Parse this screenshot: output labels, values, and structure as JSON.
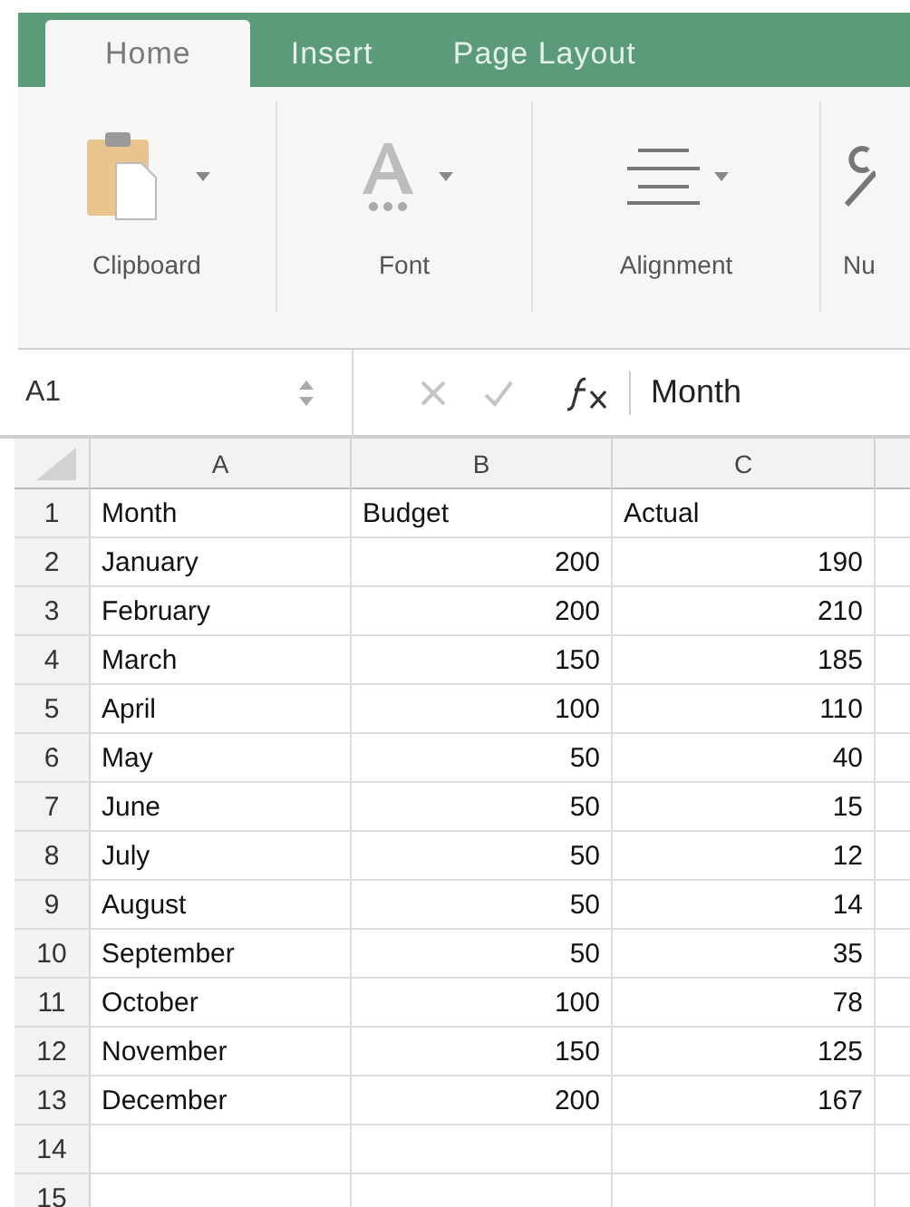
{
  "tabs": [
    {
      "label": "Home",
      "selected": true
    },
    {
      "label": "Insert",
      "selected": false
    },
    {
      "label": "Page Layout",
      "selected": false
    }
  ],
  "ribbon": {
    "groups": [
      {
        "label": "Clipboard",
        "kind": "clipboard"
      },
      {
        "label": "Font",
        "kind": "font"
      },
      {
        "label": "Alignment",
        "kind": "alignment"
      },
      {
        "label": "Nu",
        "kind": "number"
      }
    ]
  },
  "formula_bar": {
    "name_box": "A1",
    "formula": "Month"
  },
  "sheet": {
    "columns": [
      "A",
      "B",
      "C"
    ],
    "rows": [
      {
        "number": "1",
        "kind": "text",
        "cells": [
          "Month",
          "Budget",
          "Actual"
        ]
      },
      {
        "number": "2",
        "kind": "number",
        "cells": [
          "January",
          "200",
          "190"
        ]
      },
      {
        "number": "3",
        "kind": "number",
        "cells": [
          "February",
          "200",
          "210"
        ]
      },
      {
        "number": "4",
        "kind": "number",
        "cells": [
          "March",
          "150",
          "185"
        ]
      },
      {
        "number": "5",
        "kind": "number",
        "cells": [
          "April",
          "100",
          "110"
        ]
      },
      {
        "number": "6",
        "kind": "number",
        "cells": [
          "May",
          "50",
          "40"
        ]
      },
      {
        "number": "7",
        "kind": "number",
        "cells": [
          "June",
          "50",
          "15"
        ]
      },
      {
        "number": "8",
        "kind": "number",
        "cells": [
          "July",
          "50",
          "12"
        ]
      },
      {
        "number": "9",
        "kind": "number",
        "cells": [
          "August",
          "50",
          "14"
        ]
      },
      {
        "number": "10",
        "kind": "number",
        "cells": [
          "September",
          "50",
          "35"
        ]
      },
      {
        "number": "11",
        "kind": "number",
        "cells": [
          "October",
          "100",
          "78"
        ]
      },
      {
        "number": "12",
        "kind": "number",
        "cells": [
          "November",
          "150",
          "125"
        ]
      },
      {
        "number": "13",
        "kind": "number",
        "cells": [
          "December",
          "200",
          "167"
        ]
      },
      {
        "number": "14",
        "kind": "number",
        "cells": []
      },
      {
        "number": "15",
        "kind": "number",
        "cells": []
      }
    ]
  }
}
